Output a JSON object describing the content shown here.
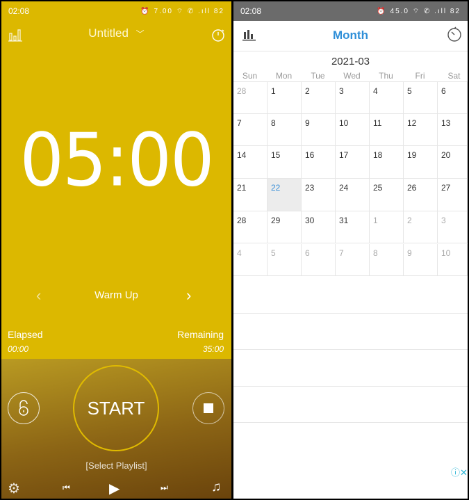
{
  "left": {
    "status": {
      "time": "02:08",
      "icons": "⏰ 7.00 ⌔ ✆ .ıll 82"
    },
    "title": "Untitled",
    "timer": "05:00",
    "interval": "Warm Up",
    "elapsed_label": "Elapsed",
    "elapsed_value": "00:00",
    "remaining_label": "Remaining",
    "remaining_value": "35:00",
    "start_label": "START",
    "playlist": "[Select Playlist]",
    "accent": "#dcb800"
  },
  "right": {
    "status": {
      "time": "02:08",
      "icons": "⏰ 45.0 ⌔ ✆ .ıll 82"
    },
    "title": "Month",
    "month": "2021-03",
    "weekdays": [
      "Sun",
      "Mon",
      "Tue",
      "Wed",
      "Thu",
      "Fri",
      "Sat"
    ],
    "weeks": [
      [
        "28",
        "1",
        "2",
        "3",
        "4",
        "5",
        "6"
      ],
      [
        "7",
        "8",
        "9",
        "10",
        "11",
        "12",
        "13"
      ],
      [
        "14",
        "15",
        "16",
        "17",
        "18",
        "19",
        "20"
      ],
      [
        "21",
        "22",
        "23",
        "24",
        "25",
        "26",
        "27"
      ],
      [
        "28",
        "29",
        "30",
        "31",
        "1",
        "2",
        "3"
      ],
      [
        "4",
        "5",
        "6",
        "7",
        "8",
        "9",
        "10"
      ]
    ],
    "today": "22",
    "accent": "#2f8fd8"
  }
}
